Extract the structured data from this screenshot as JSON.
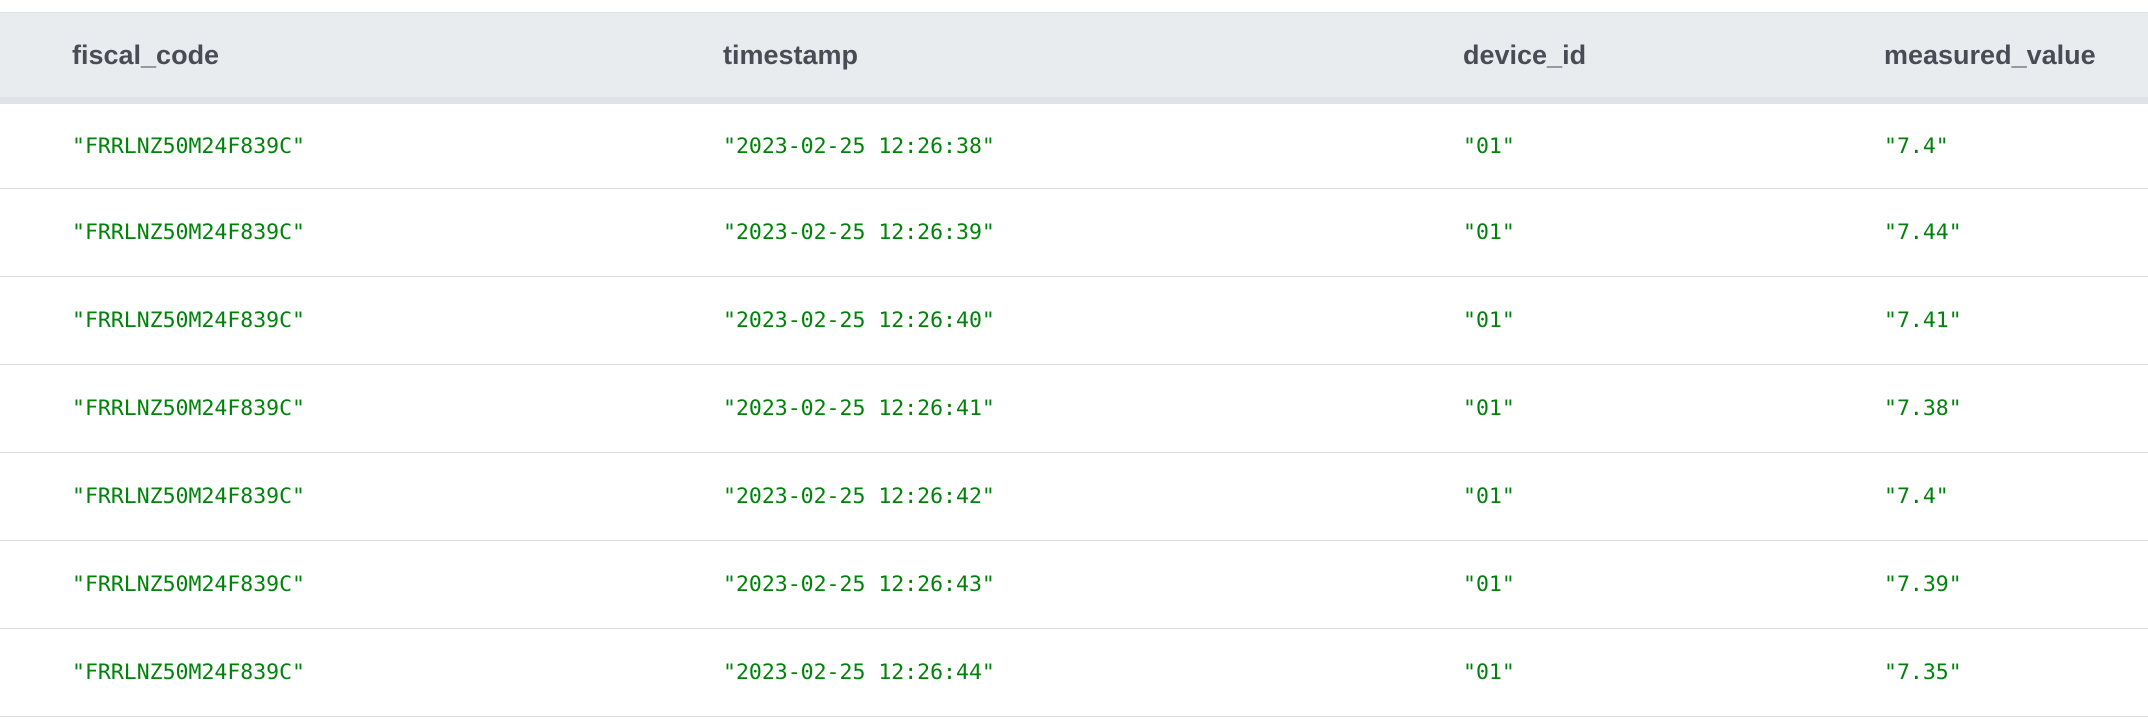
{
  "table": {
    "columns": [
      "fiscal_code",
      "timestamp",
      "device_id",
      "measured_value"
    ],
    "rows": [
      {
        "fiscal_code": "\"FRRLNZ50M24F839C\"",
        "timestamp": "\"2023-02-25 12:26:38\"",
        "device_id": "\"01\"",
        "measured_value": "\"7.4\""
      },
      {
        "fiscal_code": "\"FRRLNZ50M24F839C\"",
        "timestamp": "\"2023-02-25 12:26:39\"",
        "device_id": "\"01\"",
        "measured_value": "\"7.44\""
      },
      {
        "fiscal_code": "\"FRRLNZ50M24F839C\"",
        "timestamp": "\"2023-02-25 12:26:40\"",
        "device_id": "\"01\"",
        "measured_value": "\"7.41\""
      },
      {
        "fiscal_code": "\"FRRLNZ50M24F839C\"",
        "timestamp": "\"2023-02-25 12:26:41\"",
        "device_id": "\"01\"",
        "measured_value": "\"7.38\""
      },
      {
        "fiscal_code": "\"FRRLNZ50M24F839C\"",
        "timestamp": "\"2023-02-25 12:26:42\"",
        "device_id": "\"01\"",
        "measured_value": "\"7.4\""
      },
      {
        "fiscal_code": "\"FRRLNZ50M24F839C\"",
        "timestamp": "\"2023-02-25 12:26:43\"",
        "device_id": "\"01\"",
        "measured_value": "\"7.39\""
      },
      {
        "fiscal_code": "\"FRRLNZ50M24F839C\"",
        "timestamp": "\"2023-02-25 12:26:44\"",
        "device_id": "\"01\"",
        "measured_value": "\"7.35\""
      }
    ]
  },
  "colors": {
    "header_bg": "#e9ecef",
    "header_text": "#484d55",
    "value_text": "#00820a",
    "row_border": "#d9dcdf"
  }
}
